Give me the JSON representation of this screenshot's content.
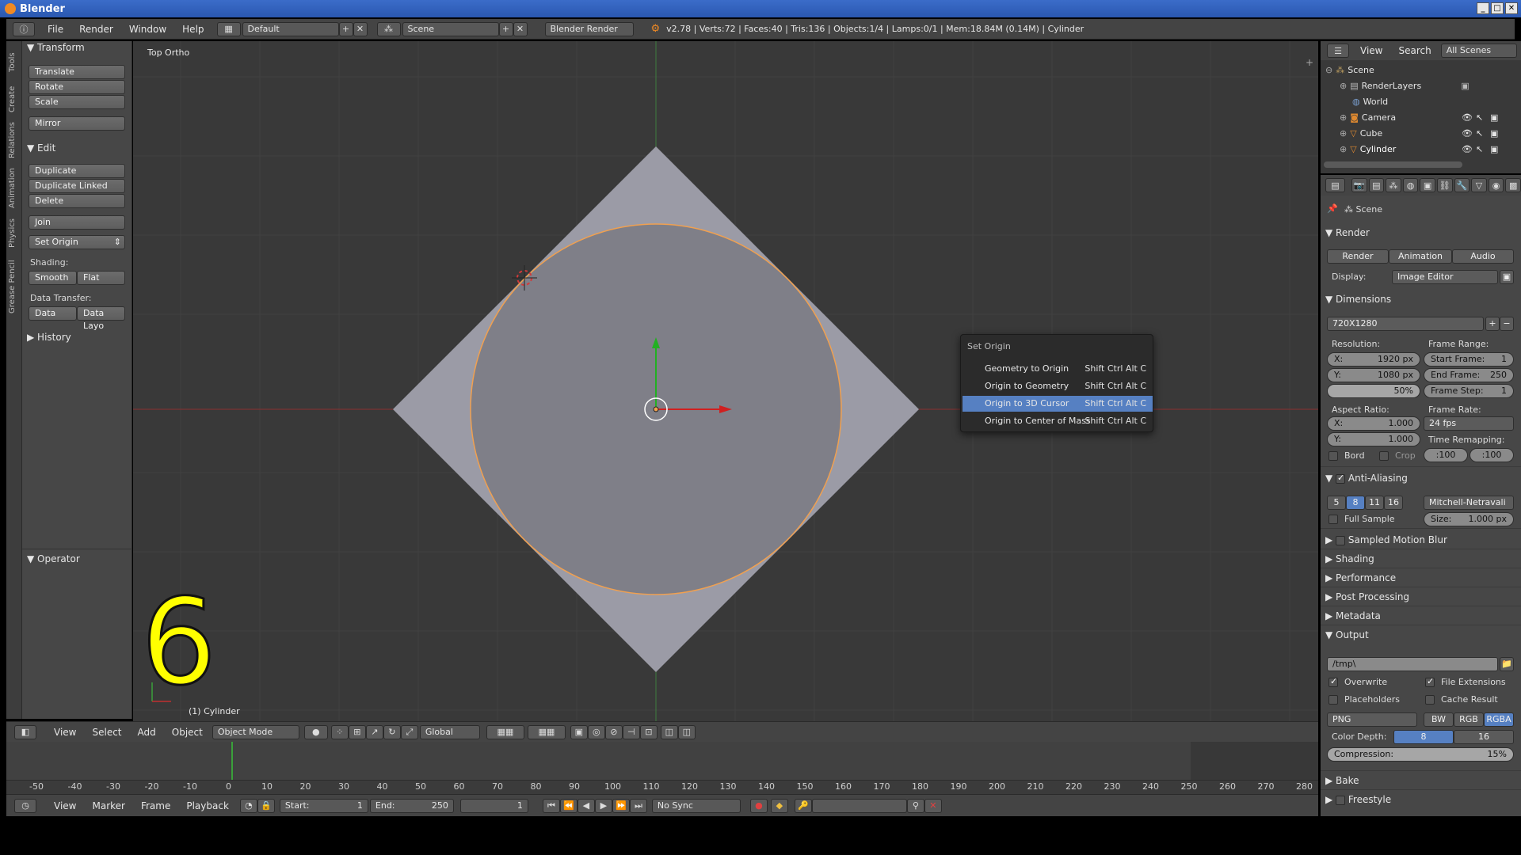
{
  "window": {
    "title": "Blender"
  },
  "infobar": {
    "menus": [
      "File",
      "Render",
      "Window",
      "Help"
    ],
    "layout": "Default",
    "scene": "Scene",
    "engine": "Blender Render",
    "stats": "v2.78 | Verts:72 | Faces:40 | Tris:136 | Objects:1/4 | Lamps:0/1 | Mem:18.84M (0.14M) | Cylinder"
  },
  "tool_tabs": [
    "Tools",
    "Create",
    "Relations",
    "Animation",
    "Physics",
    "Grease Pencil"
  ],
  "tools": {
    "transform_header": "Transform",
    "translate": "Translate",
    "rotate": "Rotate",
    "scale": "Scale",
    "mirror": "Mirror",
    "edit_header": "Edit",
    "duplicate": "Duplicate",
    "duplicate_linked": "Duplicate Linked",
    "delete": "Delete",
    "join": "Join",
    "set_origin": "Set Origin",
    "shading_label": "Shading:",
    "smooth": "Smooth",
    "flat": "Flat",
    "data_transfer_label": "Data Transfer:",
    "data": "Data",
    "data_layout": "Data Layo",
    "history_header": "History",
    "operator_header": "Operator"
  },
  "viewport": {
    "view_name": "Top Ortho",
    "big_number": "6",
    "object_label": "(1) Cylinder"
  },
  "popup": {
    "title": "Set Origin",
    "items": [
      {
        "label": "Geometry to Origin",
        "shortcut": "Shift Ctrl Alt C"
      },
      {
        "label": "Origin to Geometry",
        "shortcut": "Shift Ctrl Alt C"
      },
      {
        "label": "Origin to 3D Cursor",
        "shortcut": "Shift Ctrl Alt C"
      },
      {
        "label": "Origin to Center of Mass",
        "shortcut": "Shift Ctrl Alt C"
      }
    ],
    "highlighted_index": 2
  },
  "view_header": {
    "menus": [
      "View",
      "Select",
      "Add",
      "Object"
    ],
    "mode": "Object Mode",
    "orientation": "Global"
  },
  "timeline": {
    "ticks": [
      "-50",
      "-40",
      "-30",
      "-20",
      "-10",
      "0",
      "10",
      "20",
      "30",
      "40",
      "50",
      "60",
      "70",
      "80",
      "90",
      "100",
      "110",
      "120",
      "130",
      "140",
      "150",
      "160",
      "170",
      "180",
      "190",
      "200",
      "210",
      "220",
      "230",
      "240",
      "250",
      "260",
      "270",
      "280"
    ],
    "current_frame_marker": 1
  },
  "timeline_header": {
    "menus": [
      "View",
      "Marker",
      "Frame",
      "Playback"
    ],
    "start_label": "Start:",
    "start_value": "1",
    "end_label": "End:",
    "end_value": "250",
    "current": "1",
    "sync": "No Sync"
  },
  "outliner": {
    "header_menus": [
      "View",
      "Search"
    ],
    "filter": "All Scenes",
    "rows": [
      {
        "name": "Scene",
        "indent": 0
      },
      {
        "name": "RenderLayers",
        "indent": 1
      },
      {
        "name": "World",
        "indent": 1
      },
      {
        "name": "Camera",
        "indent": 1
      },
      {
        "name": "Cube",
        "indent": 1
      },
      {
        "name": "Cylinder",
        "indent": 1
      }
    ]
  },
  "properties": {
    "context": "Scene",
    "render_header": "Render",
    "render_btn": "Render",
    "animation_btn": "Animation",
    "audio_btn": "Audio",
    "display_label": "Display:",
    "display_value": "Image Editor",
    "dimensions_header": "Dimensions",
    "preset": "720X1280",
    "resolution_label": "Resolution:",
    "res_x_label": "X:",
    "res_x": "1920 px",
    "res_y_label": "Y:",
    "res_y": "1080 px",
    "res_pct": "50%",
    "frame_range_label": "Frame Range:",
    "start_frame_label": "Start Frame:",
    "start_frame": "1",
    "end_frame_label": "End Frame:",
    "end_frame": "250",
    "frame_step_label": "Frame Step:",
    "frame_step": "1",
    "aspect_label": "Aspect Ratio:",
    "aspect_x_label": "X:",
    "aspect_x": "1.000",
    "aspect_y_label": "Y:",
    "aspect_y": "1.000",
    "frame_rate_label": "Frame Rate:",
    "frame_rate": "24 fps",
    "time_remap_label": "Time Remapping:",
    "remap_old": ":100",
    "remap_new": ":100",
    "bord": "Bord",
    "crop": "Crop",
    "aa_header": "Anti-Aliasing",
    "aa_samples": [
      "5",
      "8",
      "11",
      "16"
    ],
    "aa_selected": "8",
    "aa_filter": "Mitchell-Netravali",
    "full_sample": "Full Sample",
    "size_label": "Size:",
    "size_value": "1.000 px",
    "motion_blur": "Sampled Motion Blur",
    "shading": "Shading",
    "performance": "Performance",
    "post_processing": "Post Processing",
    "metadata": "Metadata",
    "output_header": "Output",
    "output_path": "/tmp\\",
    "overwrite": "Overwrite",
    "file_extensions": "File Extensions",
    "placeholders": "Placeholders",
    "cache_result": "Cache Result",
    "format": "PNG",
    "bw": "BW",
    "rgb": "RGB",
    "rgba": "RGBA",
    "color_depth_label": "Color Depth:",
    "depth_8": "8",
    "depth_16": "16",
    "compression_label": "Compression:",
    "compression": "15%",
    "bake": "Bake",
    "freestyle": "Freestyle"
  },
  "colors": {
    "accent": "#5680c2",
    "mesh_fill": "#9b9ba6",
    "selection_outline": "#f0a050",
    "x_axis": "#c03030",
    "y_axis": "#3aa03a",
    "big_number": "#ffff00"
  }
}
